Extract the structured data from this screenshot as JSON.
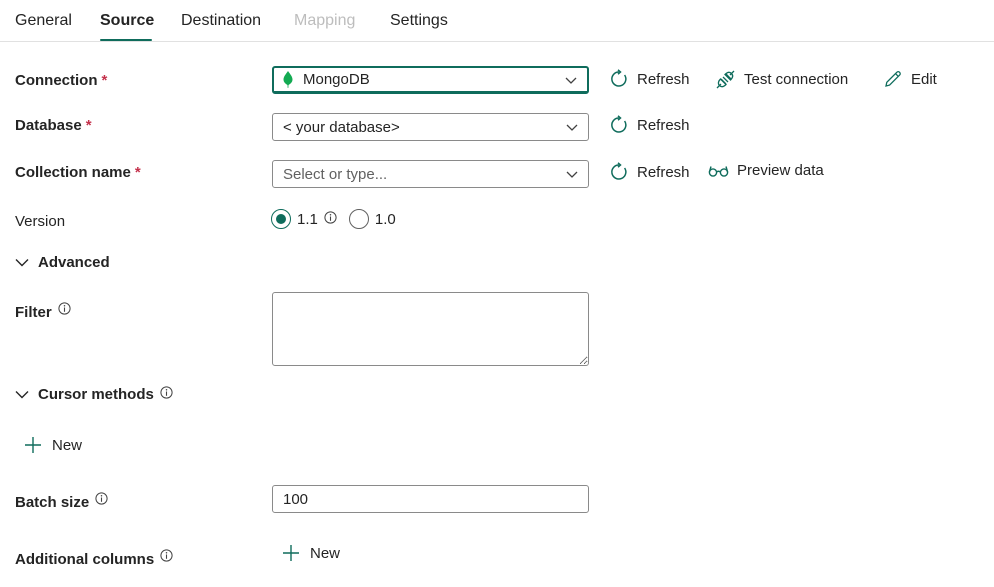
{
  "tabs": [
    {
      "label": "General"
    },
    {
      "label": "Source"
    },
    {
      "label": "Destination"
    },
    {
      "label": "Mapping"
    },
    {
      "label": "Settings"
    }
  ],
  "required_mark": "*",
  "connection": {
    "label": "Connection",
    "value": "MongoDB",
    "refresh_label": "Refresh",
    "test_label": "Test connection",
    "edit_label": "Edit"
  },
  "database": {
    "label": "Database",
    "value": "< your database>",
    "refresh_label": "Refresh"
  },
  "collection": {
    "label": "Collection name",
    "placeholder": "Select or type...",
    "refresh_label": "Refresh",
    "preview_label": "Preview data"
  },
  "version": {
    "label": "Version",
    "options": [
      {
        "label": "1.1",
        "selected": true
      },
      {
        "label": "1.0",
        "selected": false
      }
    ]
  },
  "advanced": {
    "label": "Advanced"
  },
  "filter": {
    "label": "Filter",
    "value": ""
  },
  "cursor_methods": {
    "label": "Cursor methods",
    "new_label": "New"
  },
  "batch_size": {
    "label": "Batch size",
    "value": "100"
  },
  "additional_columns": {
    "label": "Additional columns",
    "new_label": "New"
  },
  "colors": {
    "accent": "#0f6c5c",
    "required": "#c4314b",
    "mongo_leaf": "#13aa52",
    "disabled_tab": "#bdbdbd"
  },
  "icons": [
    "mongodb-leaf-icon",
    "chevron-down-icon",
    "refresh-icon",
    "test-connection-icon",
    "edit-pencil-icon",
    "preview-glasses-icon",
    "info-icon",
    "add-icon"
  ]
}
